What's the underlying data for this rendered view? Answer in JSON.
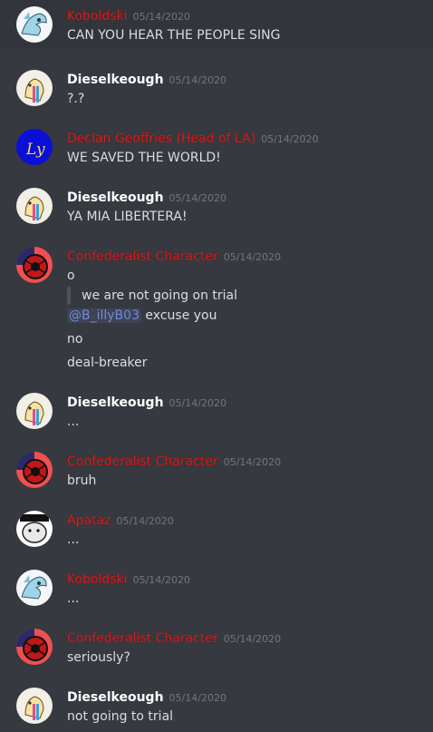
{
  "messages": [
    {
      "author": "Koboldski",
      "author_style": "red",
      "avatar": "kobold",
      "timestamp": "05/14/2020",
      "lines": [
        {
          "text": "CAN YOU HEAR THE PEOPLE SING"
        }
      ]
    },
    {
      "author": "Dieselkeough",
      "author_style": "white",
      "avatar": "diesel",
      "timestamp": "05/14/2020",
      "lines": [
        {
          "text": "?.?"
        }
      ]
    },
    {
      "author": "Declan Geoffries (Head of LA)",
      "author_style": "red",
      "avatar": "declan",
      "timestamp": "05/14/2020",
      "lines": [
        {
          "text": "WE SAVED THE WORLD!"
        }
      ]
    },
    {
      "author": "Dieselkeough",
      "author_style": "white",
      "avatar": "diesel",
      "timestamp": "05/14/2020",
      "lines": [
        {
          "text": "YA MIA LIBERTERA!"
        }
      ]
    },
    {
      "author": "Confederalist Character",
      "author_style": "red",
      "avatar": "confed",
      "timestamp": "05/14/2020",
      "lines": [
        {
          "text": "o"
        },
        {
          "text": "we are not going on trial",
          "quote": true
        },
        {
          "mention": "@B_illyB03",
          "text": " excuse you"
        },
        {
          "text": "no"
        },
        {
          "text": "deal-breaker"
        }
      ]
    },
    {
      "author": "Dieselkeough",
      "author_style": "white",
      "avatar": "diesel",
      "timestamp": "05/14/2020",
      "lines": [
        {
          "text": "..."
        }
      ]
    },
    {
      "author": "Confederalist Character",
      "author_style": "red",
      "avatar": "confed",
      "timestamp": "05/14/2020",
      "lines": [
        {
          "text": "bruh"
        }
      ]
    },
    {
      "author": "Apataz",
      "author_style": "red",
      "avatar": "apataz",
      "timestamp": "05/14/2020",
      "lines": [
        {
          "text": "..."
        }
      ]
    },
    {
      "author": "Koboldski",
      "author_style": "red",
      "avatar": "kobold",
      "timestamp": "05/14/2020",
      "lines": [
        {
          "text": "..."
        }
      ]
    },
    {
      "author": "Confederalist Character",
      "author_style": "red",
      "avatar": "confed",
      "timestamp": "05/14/2020",
      "lines": [
        {
          "text": "seriously?"
        }
      ]
    },
    {
      "author": "Dieselkeough",
      "author_style": "white",
      "avatar": "diesel",
      "timestamp": "05/14/2020",
      "lines": [
        {
          "text": "not going to trial"
        }
      ]
    }
  ],
  "colors": {
    "background": "#36393f",
    "highlight": "#32353b",
    "text": "#dcddde",
    "timestamp": "#72767d",
    "red_author": "#e01e1e",
    "mention": "#7289da"
  }
}
